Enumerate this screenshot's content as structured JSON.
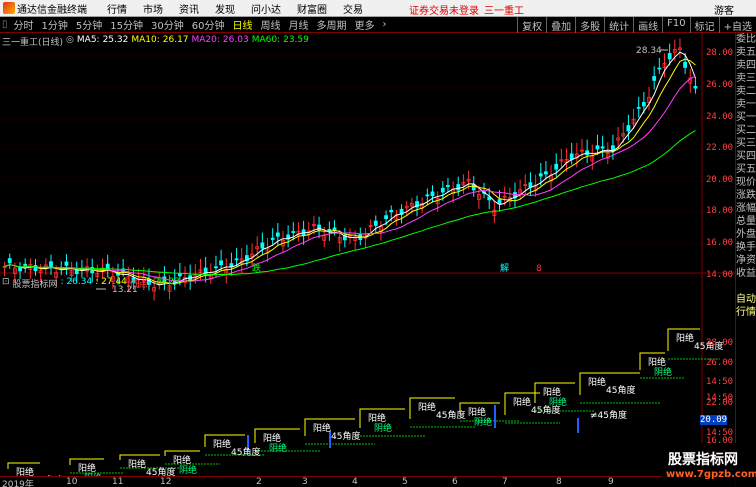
{
  "menubar": {
    "app_title": "通达信金融终端",
    "items": [
      "行情",
      "市场",
      "资讯",
      "发现",
      "问小达",
      "财富圈",
      "交易"
    ],
    "notice": "证券交易未登录",
    "stock_title": "三一重工",
    "guest": "游客"
  },
  "periods": [
    "分时",
    "1分钟",
    "5分钟",
    "15分钟",
    "30分钟",
    "60分钟",
    "日线",
    "周线",
    "月线",
    "多周期",
    "更多"
  ],
  "active_period": "日线",
  "right_tools": [
    "复权",
    "叠加",
    "多股",
    "统计",
    "画线",
    "F10",
    "标记",
    "+自选"
  ],
  "main_legend": {
    "name": "三一重工(日线)",
    "ma5_label": "MA5:",
    "ma5": "25.32",
    "ma10_label": "MA10:",
    "ma10": "26.17",
    "ma20_label": "MA20:",
    "ma20": "26.03",
    "ma60_label": "MA60:",
    "ma60": "23.59"
  },
  "indicator_legend": {
    "name": "股票指标网",
    "v1": ": 26.34",
    "v2": ": 27.44",
    "low_label": "低点:",
    "low": "20.23"
  },
  "main_axis": [
    "28.00",
    "26.00",
    "24.00",
    "22.00",
    "20.00",
    "18.00",
    "16.00",
    "14.00"
  ],
  "ind_axis": [
    "28.00",
    "26.00",
    "14:50",
    "14:50",
    "22.00",
    "20.09",
    "14:50",
    "16.00",
    "14:50"
  ],
  "ind_axis_highlight": "20.09",
  "annotations": {
    "high": "28.34",
    "low": "13.21",
    "mark1": "跌",
    "mark2": "解",
    "mark3": "8"
  },
  "ind_labels": {
    "yangjue": "阳绝",
    "yinjue": "阴绝",
    "angle45": "45角度",
    "angle45b": "≠45角度"
  },
  "side_panel": [
    "委比",
    "卖五",
    "卖四",
    "卖三",
    "卖二",
    "卖一",
    "买一",
    "买二",
    "买三",
    "买四",
    "买五",
    "现价",
    "涨跌",
    "涨幅",
    "总量",
    "外盘",
    "换手",
    "净资",
    "收益",
    "",
    "自动",
    "行情"
  ],
  "xaxis": [
    "2019年",
    "10",
    "11",
    "12",
    "2",
    "3",
    "4",
    "5",
    "6",
    "7",
    "8",
    "9"
  ],
  "watermark": {
    "text": "股票指标网",
    "url": "www.7gpzb.com"
  },
  "colors": {
    "ma5": "#ffffff",
    "ma10": "#ffff00",
    "ma20": "#ff40ff",
    "ma60": "#00ff00",
    "up": "#ff3030",
    "down": "#00ffff",
    "axis": "#ff4040",
    "border": "#800000"
  }
}
